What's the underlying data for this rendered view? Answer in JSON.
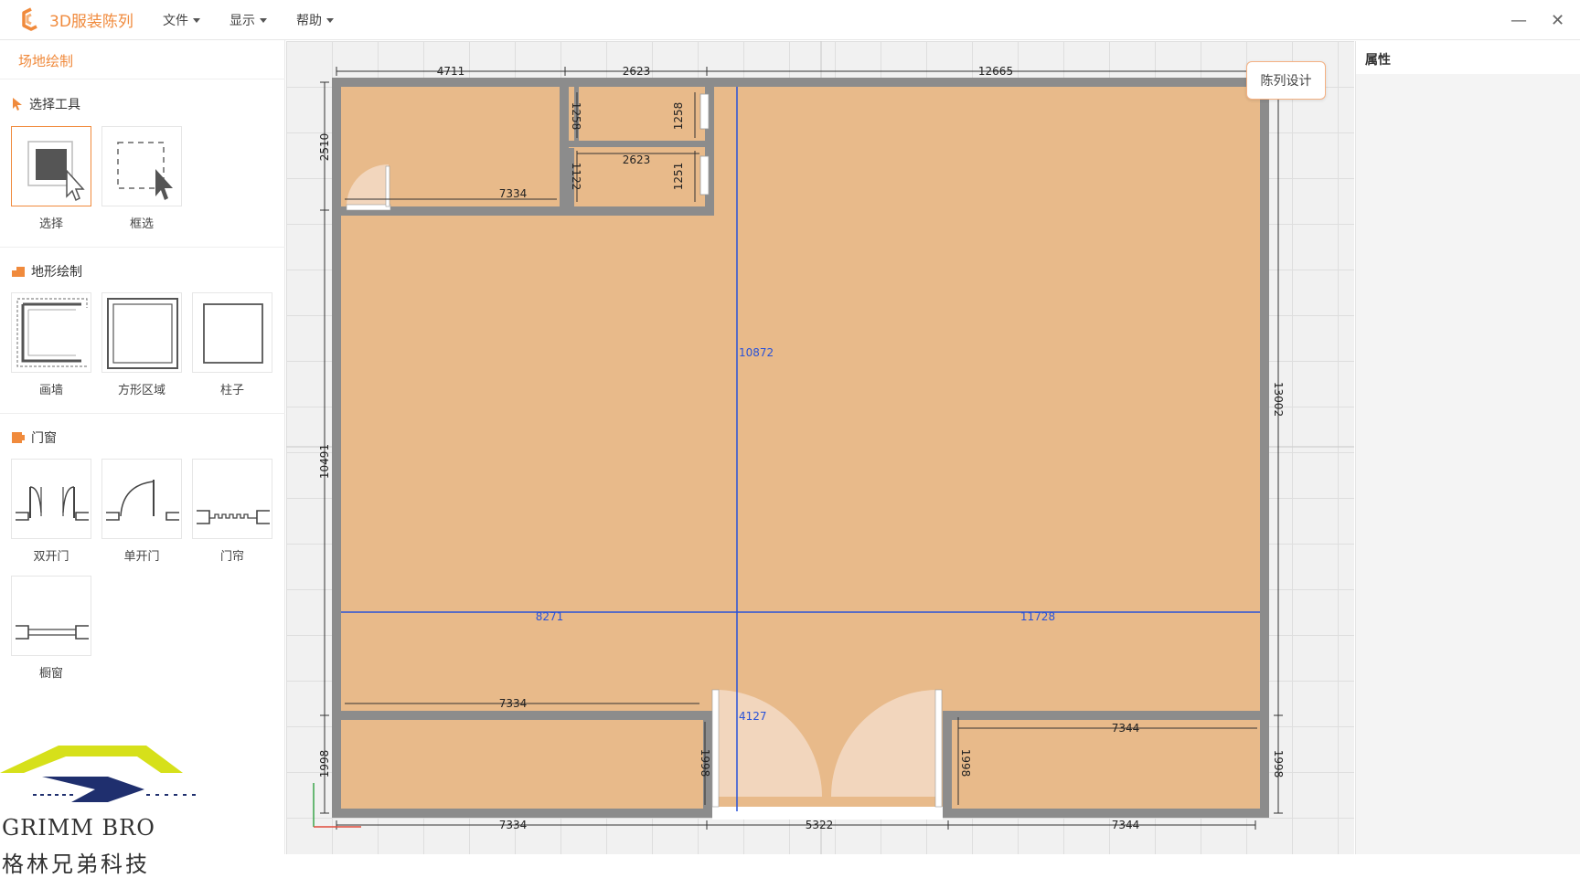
{
  "app": {
    "title": "3D服装陈列",
    "accent": "#f08a3c"
  },
  "menu": [
    {
      "label": "文件"
    },
    {
      "label": "显示"
    },
    {
      "label": "帮助"
    }
  ],
  "window": {
    "minimize": "—",
    "close": "✕"
  },
  "sidebar": {
    "panel_title": "场地绘制",
    "sections": [
      {
        "title": "选择工具",
        "icon": "cursor-icon",
        "tools": [
          {
            "label": "选择",
            "icon": "select-icon",
            "active": true
          },
          {
            "label": "框选",
            "icon": "box-select-icon"
          }
        ]
      },
      {
        "title": "地形绘制",
        "icon": "terrain-icon",
        "tools": [
          {
            "label": "画墙",
            "icon": "draw-wall-icon"
          },
          {
            "label": "方形区域",
            "icon": "square-area-icon"
          },
          {
            "label": "柱子",
            "icon": "pillar-icon"
          }
        ]
      },
      {
        "title": "门窗",
        "icon": "door-window-icon",
        "tools": [
          {
            "label": "双开门",
            "icon": "double-door-icon"
          },
          {
            "label": "单开门",
            "icon": "single-door-icon"
          },
          {
            "label": "门帘",
            "icon": "door-curtain-icon"
          },
          {
            "label": "橱窗",
            "icon": "showcase-window-icon"
          }
        ]
      }
    ]
  },
  "brand": {
    "name_en": "GRIMM BRO",
    "name_cn": "格林兄弟科技"
  },
  "canvas": {
    "design_button": "陈列设计",
    "floor_color": "#e8ba8a",
    "wall_color": "#8c8c8c",
    "guide_color": "#2952d8",
    "dimensions": {
      "top_1": "4711",
      "top_2": "2623",
      "top_3": "12665",
      "left_1": "2510",
      "left_2": "10491",
      "left_3": "1998",
      "right_1": "13002",
      "right_2": "1998",
      "bottom_1": "7334",
      "bottom_2": "5322",
      "bottom_3": "7344",
      "room_a_width": "7334",
      "room_b_height_1": "1258",
      "room_b_height_2": "1258",
      "room_c_width": "2623",
      "room_c_height_1": "1122",
      "room_c_height_2": "1251",
      "lower_left_width": "7334",
      "lower_left_height": "1998",
      "lower_right_width": "7344",
      "lower_right_height": "1998"
    },
    "guides": {
      "vertical": "10872",
      "left_span": "8271",
      "right_span": "11728",
      "door_gap": "4127"
    }
  },
  "properties": {
    "title": "属性"
  }
}
